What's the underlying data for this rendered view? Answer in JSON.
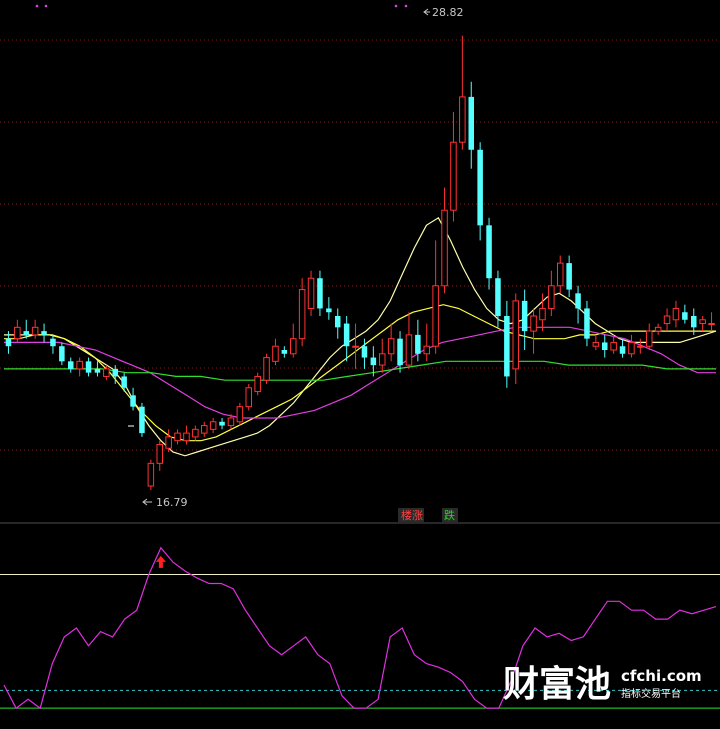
{
  "chart_data": {
    "type": "candlestick",
    "price_panel": {
      "ylim": [
        16.0,
        29.5
      ],
      "high_label": "28.82",
      "low_label": "16.79",
      "candles": [
        [
          0,
          20.8,
          20.6,
          21.0,
          20.4
        ],
        [
          1,
          20.8,
          21.1,
          21.3,
          20.7
        ],
        [
          2,
          21.0,
          20.9,
          21.3,
          20.8
        ],
        [
          3,
          20.9,
          21.1,
          21.3,
          20.8
        ],
        [
          4,
          21.0,
          20.9,
          21.2,
          20.7
        ],
        [
          5,
          20.8,
          20.6,
          20.9,
          20.4
        ],
        [
          6,
          20.6,
          20.2,
          20.7,
          20.1
        ],
        [
          7,
          20.2,
          20.0,
          20.3,
          19.9
        ],
        [
          8,
          20.0,
          20.2,
          20.3,
          19.8
        ],
        [
          9,
          20.2,
          19.9,
          20.3,
          19.8
        ],
        [
          10,
          20.0,
          19.9,
          20.2,
          19.8
        ],
        [
          11,
          19.8,
          20.0,
          20.1,
          19.7
        ],
        [
          12,
          20.0,
          19.8,
          20.1,
          19.6
        ],
        [
          13,
          19.8,
          19.5,
          19.9,
          19.4
        ],
        [
          14,
          19.3,
          19.0,
          19.5,
          18.9
        ],
        [
          15,
          19.0,
          18.3,
          19.1,
          18.2
        ],
        [
          16,
          16.9,
          17.5,
          17.6,
          16.79
        ],
        [
          17,
          17.5,
          18.0,
          18.1,
          17.3
        ],
        [
          18,
          17.9,
          18.2,
          18.4,
          17.8
        ],
        [
          19,
          18.1,
          18.3,
          18.4,
          18.0
        ],
        [
          20,
          18.1,
          18.3,
          18.5,
          18.0
        ],
        [
          21,
          18.2,
          18.4,
          18.5,
          18.1
        ],
        [
          22,
          18.3,
          18.5,
          18.6,
          18.2
        ],
        [
          23,
          18.4,
          18.6,
          18.7,
          18.3
        ],
        [
          24,
          18.6,
          18.5,
          18.7,
          18.4
        ],
        [
          25,
          18.5,
          18.7,
          18.8,
          18.4
        ],
        [
          26,
          18.6,
          19.0,
          19.1,
          18.5
        ],
        [
          27,
          19.0,
          19.5,
          19.6,
          18.9
        ],
        [
          28,
          19.4,
          19.8,
          19.9,
          19.3
        ],
        [
          29,
          19.7,
          20.3,
          20.4,
          19.6
        ],
        [
          30,
          20.2,
          20.6,
          20.8,
          20.1
        ],
        [
          31,
          20.5,
          20.4,
          20.6,
          20.3
        ],
        [
          32,
          20.4,
          20.8,
          21.2,
          20.3
        ],
        [
          33,
          20.8,
          22.1,
          22.4,
          20.6
        ],
        [
          34,
          21.6,
          22.4,
          22.6,
          21.4
        ],
        [
          35,
          22.4,
          21.6,
          22.6,
          21.4
        ],
        [
          36,
          21.6,
          21.5,
          21.9,
          21.3
        ],
        [
          37,
          21.4,
          21.1,
          21.6,
          20.8
        ],
        [
          38,
          21.2,
          20.6,
          21.4,
          20.2
        ],
        [
          39,
          20.6,
          20.6,
          21.2,
          20.0
        ],
        [
          40,
          20.6,
          20.3,
          20.8,
          20.0
        ],
        [
          41,
          20.3,
          20.1,
          20.6,
          19.8
        ],
        [
          42,
          20.1,
          20.4,
          20.8,
          19.9
        ],
        [
          43,
          20.4,
          20.8,
          21.2,
          20.2
        ],
        [
          44,
          20.8,
          20.1,
          21.0,
          19.9
        ],
        [
          45,
          20.1,
          20.9,
          21.5,
          20.0
        ],
        [
          46,
          20.9,
          20.4,
          21.3,
          20.2
        ],
        [
          47,
          20.4,
          20.6,
          21.2,
          20.2
        ],
        [
          48,
          20.6,
          22.2,
          23.4,
          20.4
        ],
        [
          49,
          22.2,
          24.2,
          24.8,
          22.0
        ],
        [
          50,
          24.2,
          26.0,
          26.8,
          23.9
        ],
        [
          51,
          26.0,
          27.2,
          28.82,
          25.8
        ],
        [
          52,
          27.2,
          25.8,
          27.6,
          25.3
        ],
        [
          53,
          25.8,
          23.8,
          26.0,
          23.4
        ],
        [
          54,
          23.8,
          22.4,
          24.0,
          22.1
        ],
        [
          55,
          22.4,
          21.4,
          22.6,
          21.1
        ],
        [
          56,
          21.4,
          19.8,
          21.8,
          19.5
        ],
        [
          57,
          20.0,
          21.8,
          22.0,
          19.6
        ],
        [
          58,
          21.8,
          21.0,
          22.1,
          20.5
        ],
        [
          59,
          21.0,
          21.4,
          21.6,
          20.4
        ],
        [
          60,
          21.3,
          21.6,
          22.0,
          21.0
        ],
        [
          61,
          21.6,
          22.2,
          22.6,
          21.4
        ],
        [
          62,
          22.2,
          22.8,
          23.0,
          22.0
        ],
        [
          63,
          22.8,
          22.1,
          23.0,
          21.9
        ],
        [
          64,
          22.0,
          21.6,
          22.2,
          21.2
        ],
        [
          65,
          21.6,
          20.8,
          21.8,
          20.6
        ],
        [
          66,
          20.6,
          20.7,
          20.9,
          20.5
        ],
        [
          67,
          20.7,
          20.5,
          20.9,
          20.3
        ],
        [
          68,
          20.5,
          20.7,
          20.9,
          20.4
        ],
        [
          69,
          20.6,
          20.4,
          20.8,
          20.3
        ],
        [
          70,
          20.4,
          20.7,
          20.9,
          20.3
        ],
        [
          71,
          20.6,
          20.6,
          20.8,
          20.4
        ],
        [
          72,
          20.6,
          21.0,
          21.2,
          20.5
        ],
        [
          73,
          21.0,
          21.1,
          21.2,
          20.9
        ],
        [
          74,
          21.2,
          21.4,
          21.6,
          21.0
        ],
        [
          75,
          21.3,
          21.6,
          21.8,
          21.1
        ],
        [
          76,
          21.5,
          21.3,
          21.7,
          21.2
        ],
        [
          77,
          21.4,
          21.1,
          21.6,
          20.9
        ],
        [
          78,
          21.2,
          21.3,
          21.4,
          21.0
        ],
        [
          79,
          21.2,
          21.2,
          21.5,
          21.0
        ]
      ],
      "moving_averages": [
        {
          "color": "#ffffaa",
          "values": [
            20.9,
            20.9,
            20.9,
            20.9,
            20.9,
            20.8,
            20.6,
            20.4,
            20.2,
            20.0,
            19.6,
            19.0,
            18.5,
            18.1,
            17.8,
            17.7,
            17.8,
            17.9,
            18.0,
            18.1,
            18.2,
            18.3,
            18.5,
            18.8,
            19.1,
            19.5,
            19.9,
            20.3,
            20.6,
            20.8,
            21.0,
            21.3,
            21.8,
            22.5,
            23.2,
            23.8,
            24.0,
            23.4,
            22.7,
            22.1,
            21.6,
            21.3,
            21.2,
            21.3,
            21.6,
            21.9,
            22.0,
            21.8,
            21.5,
            21.2,
            21.0,
            20.8,
            20.7,
            20.7,
            20.7,
            20.7,
            20.7,
            20.8,
            20.9,
            21.0
          ]
        },
        {
          "color": "#ffff40",
          "values": [
            20.8,
            20.8,
            20.9,
            20.9,
            20.8,
            20.6,
            20.3,
            19.9,
            19.4,
            18.9,
            18.5,
            18.2,
            18.1,
            18.1,
            18.2,
            18.4,
            18.6,
            18.8,
            19.0,
            19.2,
            19.5,
            19.8,
            20.1,
            20.4,
            20.7,
            21.0,
            21.3,
            21.5,
            21.6,
            21.7,
            21.6,
            21.4,
            21.2,
            21.0,
            20.9,
            20.8,
            20.8,
            20.8,
            20.9,
            20.9,
            21.0,
            21.0,
            21.0,
            21.0,
            21.0,
            21.0,
            21.0,
            21.0
          ]
        },
        {
          "color": "#e040e0",
          "values": [
            20.7,
            20.7,
            20.7,
            20.7,
            20.6,
            20.5,
            20.3,
            20.1,
            19.9,
            19.6,
            19.3,
            19.0,
            18.8,
            18.7,
            18.7,
            18.7,
            18.8,
            18.9,
            19.1,
            19.3,
            19.6,
            19.9,
            20.2,
            20.5,
            20.7,
            20.8,
            20.9,
            21.0,
            21.1,
            21.1,
            21.1,
            21.1,
            21.0,
            20.9,
            20.8,
            20.6,
            20.4,
            20.1,
            19.9,
            19.9
          ]
        },
        {
          "color": "#30e030",
          "values": [
            20.0,
            20.0,
            20.0,
            20.0,
            20.0,
            19.9,
            19.9,
            19.8,
            19.8,
            19.7,
            19.7,
            19.7,
            19.7,
            19.7,
            19.8,
            19.9,
            20.0,
            20.1,
            20.2,
            20.2,
            20.2,
            20.2,
            20.2,
            20.1,
            20.1,
            20.1,
            20.1,
            20.0,
            20.0,
            20.0
          ]
        }
      ]
    },
    "indicator_panel": {
      "ylim": [
        -5,
        105
      ],
      "upper_line": 80,
      "lower_line": 5,
      "dashed_line": 15,
      "series": {
        "color": "#e030e0",
        "values": [
          18,
          5,
          10,
          5,
          30,
          45,
          50,
          40,
          48,
          45,
          55,
          60,
          80,
          95,
          87,
          82,
          78,
          75,
          75,
          72,
          60,
          50,
          40,
          35,
          40,
          45,
          35,
          30,
          12,
          5,
          5,
          10,
          45,
          50,
          35,
          30,
          28,
          25,
          20,
          10,
          5,
          5,
          20,
          40,
          50,
          45,
          47,
          43,
          45,
          55,
          65,
          65,
          60,
          60,
          55,
          55,
          60,
          58,
          60,
          62
        ]
      },
      "markers": [
        {
          "type": "arrow-up",
          "index": 13,
          "color": "#ff2020"
        }
      ]
    },
    "badges": [
      {
        "label": "楼涨",
        "color": "#ff4040"
      },
      {
        "label": "跌",
        "color": "#30d030"
      }
    ]
  },
  "watermark": {
    "brand": "财富池",
    "url": "cfchi.com",
    "tagline": "指标交易平台"
  }
}
